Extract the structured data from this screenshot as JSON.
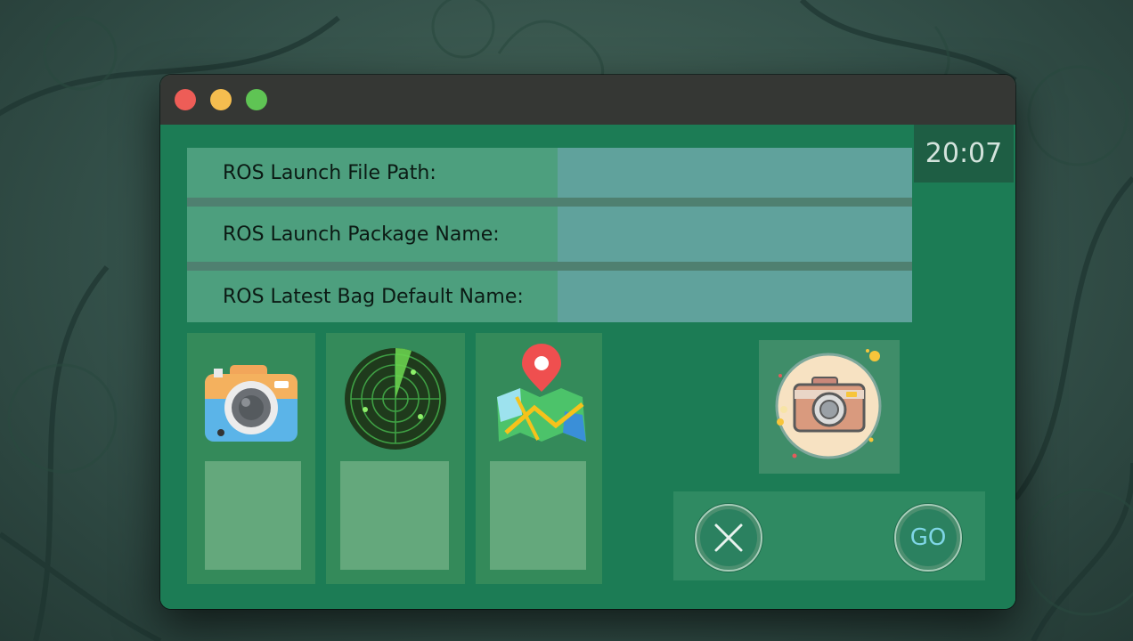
{
  "clock": {
    "time": "20:07"
  },
  "form": {
    "fields": [
      {
        "label": "ROS Launch File Path:",
        "value": ""
      },
      {
        "label": "ROS Launch Package Name:",
        "value": ""
      },
      {
        "label": "ROS Latest Bag Default Name:",
        "value": ""
      }
    ]
  },
  "tiles": [
    {
      "icon": "camera-icon"
    },
    {
      "icon": "radar-icon"
    },
    {
      "icon": "map-pin-icon"
    }
  ],
  "photo_card": {
    "icon": "photo-camera-icon"
  },
  "actions": {
    "cancel_icon": "close-icon",
    "go_label": "GO"
  },
  "colors": {
    "window_bg": "#1c7c55",
    "titlebar": "#353734",
    "field_label_bg": "#4d9f7e",
    "field_input_bg": "#60a29c",
    "tile_bg": "#348a5a",
    "clock_bg": "#1e5e44",
    "go_text": "#7fd6e6"
  }
}
